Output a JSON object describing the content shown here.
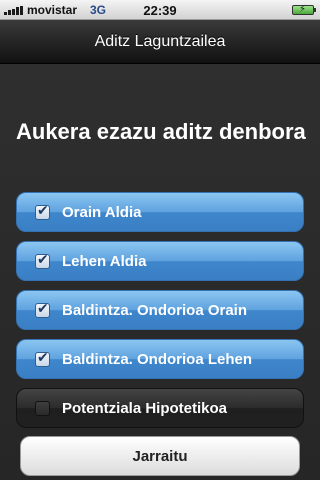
{
  "status_bar": {
    "carrier": "movistar",
    "network": "3G",
    "time": "22:39",
    "battery_icon": "battery-charging-icon"
  },
  "nav": {
    "title": "Aditz Laguntzailea"
  },
  "main": {
    "heading": "Aukera ezazu aditz denbora",
    "options": [
      {
        "label": "Orain Aldia",
        "checked": true
      },
      {
        "label": "Lehen Aldia",
        "checked": true
      },
      {
        "label": "Baldintza. Ondorioa Orain",
        "checked": true
      },
      {
        "label": "Baldintza. Ondorioa Lehen",
        "checked": true
      },
      {
        "label": "Potentziala Hipotetikoa",
        "checked": false
      }
    ],
    "continue_label": "Jarraitu"
  },
  "colors": {
    "accent_blue": "#5fa2de",
    "background": "#2e2e2e",
    "nav_bar": "#1a1a1a"
  }
}
